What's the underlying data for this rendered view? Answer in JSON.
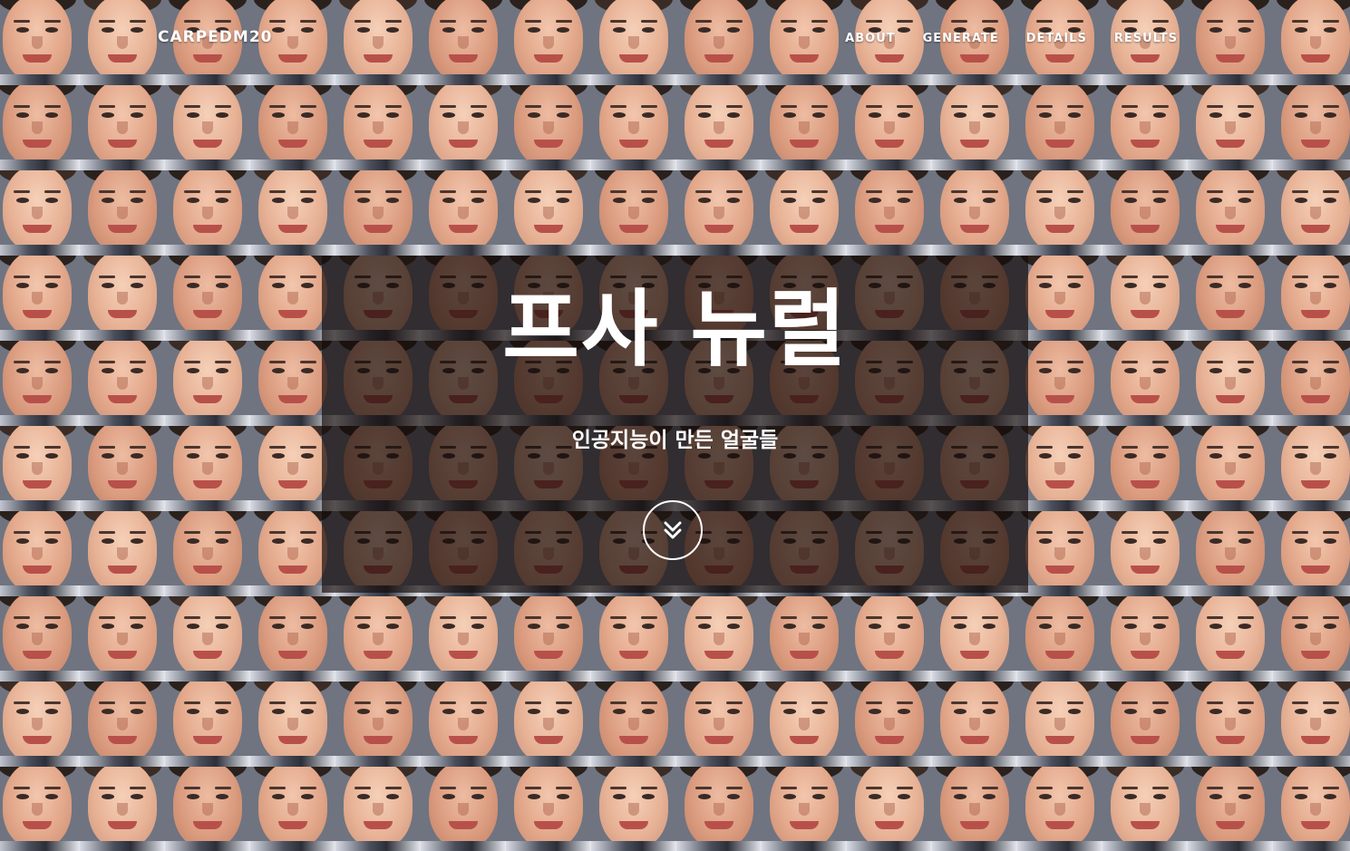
{
  "navbar": {
    "brand": "CARPEDM20",
    "links": [
      {
        "label": "ABOUT"
      },
      {
        "label": "GENERATE"
      },
      {
        "label": "DETAILS"
      },
      {
        "label": "RESULTS"
      }
    ]
  },
  "hero": {
    "title": "프사 뉴럴",
    "subtitle": "인공지능이 만든 얼굴들",
    "scroll_icon": "double-chevron-down-icon"
  },
  "background": {
    "content": "grid of AI-generated face images",
    "overlay_color": "#140c0a"
  },
  "colors": {
    "text": "#ffffff"
  }
}
